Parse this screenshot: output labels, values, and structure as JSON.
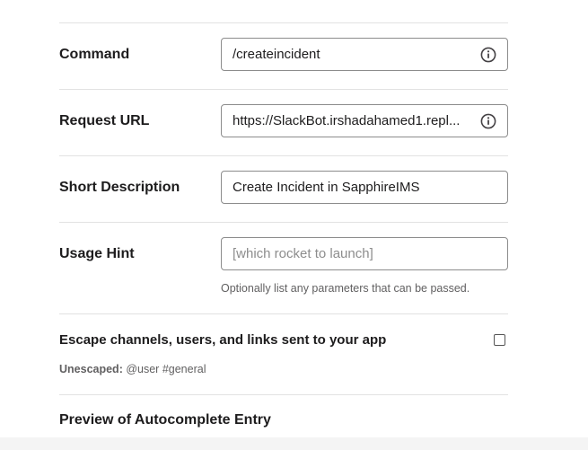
{
  "command": {
    "label": "Command",
    "value": "/createincident"
  },
  "request_url": {
    "label": "Request URL",
    "value": "https://SlackBot.irshadahamed1.repl..."
  },
  "short_description": {
    "label": "Short Description",
    "value": "Create Incident in SapphireIMS"
  },
  "usage_hint": {
    "label": "Usage Hint",
    "placeholder": "[which rocket to launch]",
    "help": "Optionally list any parameters that can be passed."
  },
  "escape": {
    "label": "Escape channels, users, and links sent to your app",
    "checked": false,
    "unescaped_prefix": "Unescaped:",
    "unescaped_example": "@user #general"
  },
  "preview": {
    "title": "Preview of Autocomplete Entry"
  },
  "icons": {
    "info": "info-circle-icon"
  },
  "colors": {
    "text": "#1d1c1d",
    "muted": "#616061",
    "border": "#8c8c8c",
    "divider": "#e2e2e2"
  }
}
